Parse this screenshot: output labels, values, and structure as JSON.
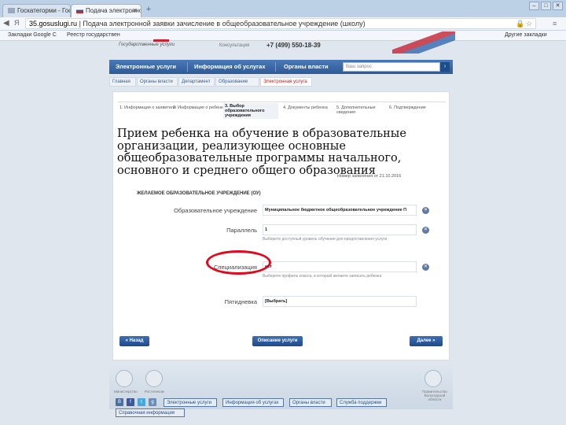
{
  "browser": {
    "tabs": [
      {
        "title": "Госкатегорми - Госу"
      },
      {
        "title": "Подача электронной з"
      }
    ],
    "new_tab": "+",
    "address": {
      "host": "35.gosuslugi.ru",
      "page_title": "Подача электронной заявки зачисление в общеобразовательное учреждение (школу)"
    },
    "bookmarks": [
      "Закладки Google С",
      "Реестр государствен"
    ],
    "other_bookmarks": "Другие закладки"
  },
  "header": {
    "tagline": "Государственные услуги",
    "contact_label": "Консультация",
    "phone": "+7 (499) 550-18-39"
  },
  "nav": {
    "items": [
      "Электронные услуги",
      "Информация об услугах",
      "Органы власти"
    ],
    "search_placeholder": "Ваш запрос",
    "search_icon": "search-icon"
  },
  "breadcrumbs": [
    "Главная",
    "Органы власти",
    "Департамент",
    "Образование",
    "Электронная услуга"
  ],
  "steps": [
    "1. Информация о заявителе",
    "2. Информация о ребенке",
    "3. Выбор образовательного учреждения",
    "4. Документы ребенка",
    "5. Дополнительные сведения",
    "6. Подтверждение"
  ],
  "title": "Прием ребенка на обучение в образовательные организации, реализующее основные общеобразовательные программы начального, основного и среднего общего образования",
  "subline": "Номер заявления от 21.10.2016",
  "section_title": "ЖЕЛАЕМОЕ ОБРАЗОВАТЕЛЬНОЕ УЧРЕЖДЕНИЕ (ОУ)",
  "fields": [
    {
      "label": "Образовательное учреждение",
      "value": "Муниципальное бюджетное общеобразовательное учреждение П",
      "hint": ""
    },
    {
      "label": "Параллель",
      "value": "1",
      "hint": "Выберите доступный уровень обучения для предоставления услуги"
    },
    {
      "label": "Специализация",
      "value": "нет",
      "hint": "Выберите профиль класса, в который желаете записать ребенка"
    },
    {
      "label": "Пятидневка",
      "value": "[Выбрать]",
      "hint": ""
    }
  ],
  "buttons": {
    "back": "« Назад",
    "description": "Описание услуги",
    "next": "Далее »"
  },
  "footer": {
    "emblem_caption": "Министерство",
    "partner_caption": "Ростелеком",
    "region_caption": "Правительство Вологодской области",
    "social": [
      "В",
      "f",
      "t",
      "g"
    ],
    "links": [
      "Электронные услуги",
      "Информация об услугах",
      "Органы власти",
      "Служба поддержки",
      "Справочная информация"
    ]
  },
  "colors": {
    "nav": "#2d5a97",
    "highlight": "#e2081e",
    "button": "#1e4a8b"
  }
}
